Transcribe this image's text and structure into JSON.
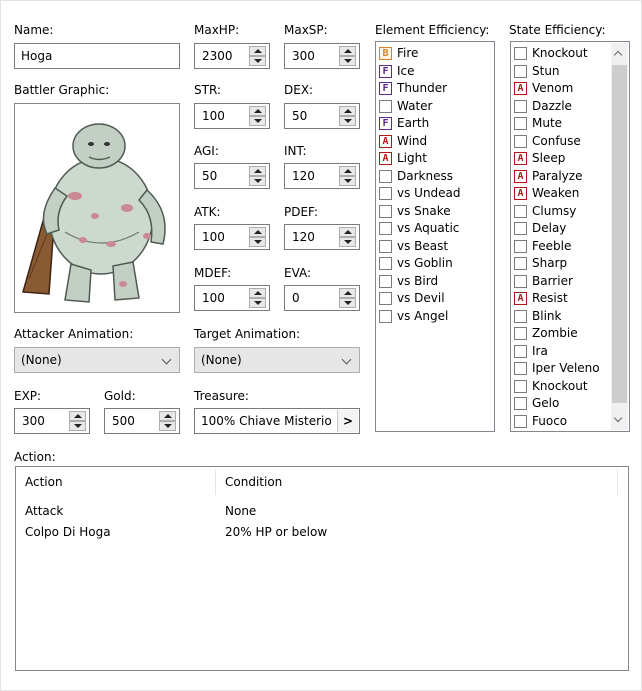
{
  "name": {
    "label": "Name:",
    "value": "Hoga"
  },
  "maxhp": {
    "label": "MaxHP:",
    "value": "2300"
  },
  "maxsp": {
    "label": "MaxSP:",
    "value": "300"
  },
  "str": {
    "label": "STR:",
    "value": "100"
  },
  "dex": {
    "label": "DEX:",
    "value": "50"
  },
  "agi": {
    "label": "AGI:",
    "value": "50"
  },
  "int": {
    "label": "INT:",
    "value": "120"
  },
  "atk": {
    "label": "ATK:",
    "value": "100"
  },
  "pdef": {
    "label": "PDEF:",
    "value": "120"
  },
  "mdef": {
    "label": "MDEF:",
    "value": "100"
  },
  "eva": {
    "label": "EVA:",
    "value": "0"
  },
  "battler_graphic": {
    "label": "Battler Graphic:"
  },
  "attacker_animation": {
    "label": "Attacker Animation:",
    "value": "(None)"
  },
  "target_animation": {
    "label": "Target Animation:",
    "value": "(None)"
  },
  "exp": {
    "label": "EXP:",
    "value": "300"
  },
  "gold": {
    "label": "Gold:",
    "value": "500"
  },
  "treasure": {
    "label": "Treasure:",
    "value": "100%  Chiave Misterio",
    "button": ">"
  },
  "element_efficiency": {
    "label": "Element Efficiency:",
    "items": [
      {
        "level": "B",
        "name": "Fire"
      },
      {
        "level": "F",
        "name": "Ice"
      },
      {
        "level": "F",
        "name": "Thunder"
      },
      {
        "level": "",
        "name": "Water"
      },
      {
        "level": "F",
        "name": "Earth"
      },
      {
        "level": "A",
        "name": "Wind"
      },
      {
        "level": "A",
        "name": "Light"
      },
      {
        "level": "",
        "name": "Darkness"
      },
      {
        "level": "",
        "name": "vs Undead"
      },
      {
        "level": "",
        "name": "vs Snake"
      },
      {
        "level": "",
        "name": "vs Aquatic"
      },
      {
        "level": "",
        "name": "vs Beast"
      },
      {
        "level": "",
        "name": "vs Goblin"
      },
      {
        "level": "",
        "name": "vs Bird"
      },
      {
        "level": "",
        "name": "vs Devil"
      },
      {
        "level": "",
        "name": "vs Angel"
      }
    ]
  },
  "state_efficiency": {
    "label": "State Efficiency:",
    "items": [
      {
        "level": "",
        "name": "Knockout"
      },
      {
        "level": "",
        "name": "Stun"
      },
      {
        "level": "A",
        "name": "Venom"
      },
      {
        "level": "",
        "name": "Dazzle"
      },
      {
        "level": "",
        "name": "Mute"
      },
      {
        "level": "",
        "name": "Confuse"
      },
      {
        "level": "A",
        "name": "Sleep"
      },
      {
        "level": "A",
        "name": "Paralyze"
      },
      {
        "level": "A",
        "name": "Weaken"
      },
      {
        "level": "",
        "name": "Clumsy"
      },
      {
        "level": "",
        "name": "Delay"
      },
      {
        "level": "",
        "name": "Feeble"
      },
      {
        "level": "",
        "name": "Sharp"
      },
      {
        "level": "",
        "name": "Barrier"
      },
      {
        "level": "A",
        "name": "Resist"
      },
      {
        "level": "",
        "name": "Blink"
      },
      {
        "level": "",
        "name": "Zombie"
      },
      {
        "level": "",
        "name": "Ira"
      },
      {
        "level": "",
        "name": "Iper Veleno"
      },
      {
        "level": "",
        "name": "Knockout"
      },
      {
        "level": "",
        "name": "Gelo"
      },
      {
        "level": "",
        "name": "Fuoco"
      }
    ]
  },
  "action": {
    "label": "Action:",
    "columns": [
      "Action",
      "Condition"
    ],
    "rows": [
      [
        "Attack",
        "None"
      ],
      [
        "Colpo Di Hoga",
        "20% HP or below"
      ]
    ]
  },
  "colors": {
    "level_B": "#d9822b",
    "level_F": "#5a2d82",
    "level_A": "#b01818",
    "combo_bg": "#e6e6e6"
  }
}
